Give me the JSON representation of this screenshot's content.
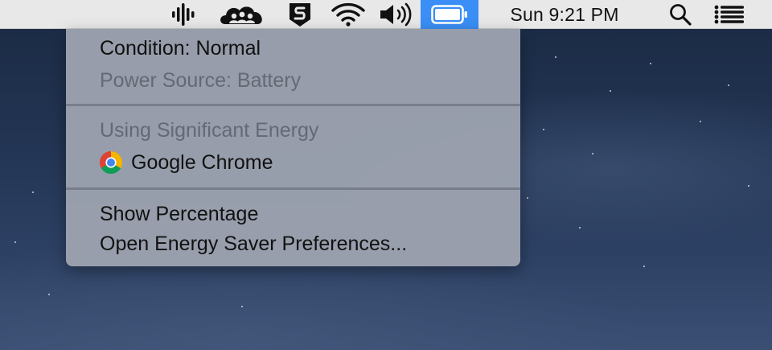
{
  "menubar": {
    "status_icons": [
      {
        "name": "audio-waveform-icon"
      },
      {
        "name": "cloud-people-icon"
      },
      {
        "name": "shield-s-icon"
      },
      {
        "name": "wifi-icon"
      },
      {
        "name": "volume-icon"
      },
      {
        "name": "battery-icon",
        "active": true
      }
    ],
    "clock": "Sun 9:21 PM",
    "search_icon": "search-icon",
    "notification_icon": "notification-list-icon",
    "active_color": "#3a8ef5"
  },
  "battery_menu": {
    "condition": "Condition: Normal",
    "power_source": "Power Source: Battery",
    "section_heading": "Using Significant Energy",
    "apps": [
      {
        "name": "Google Chrome",
        "icon": "chrome-icon"
      }
    ],
    "show_percentage": "Show Percentage",
    "open_preferences": "Open Energy Saver Preferences..."
  }
}
